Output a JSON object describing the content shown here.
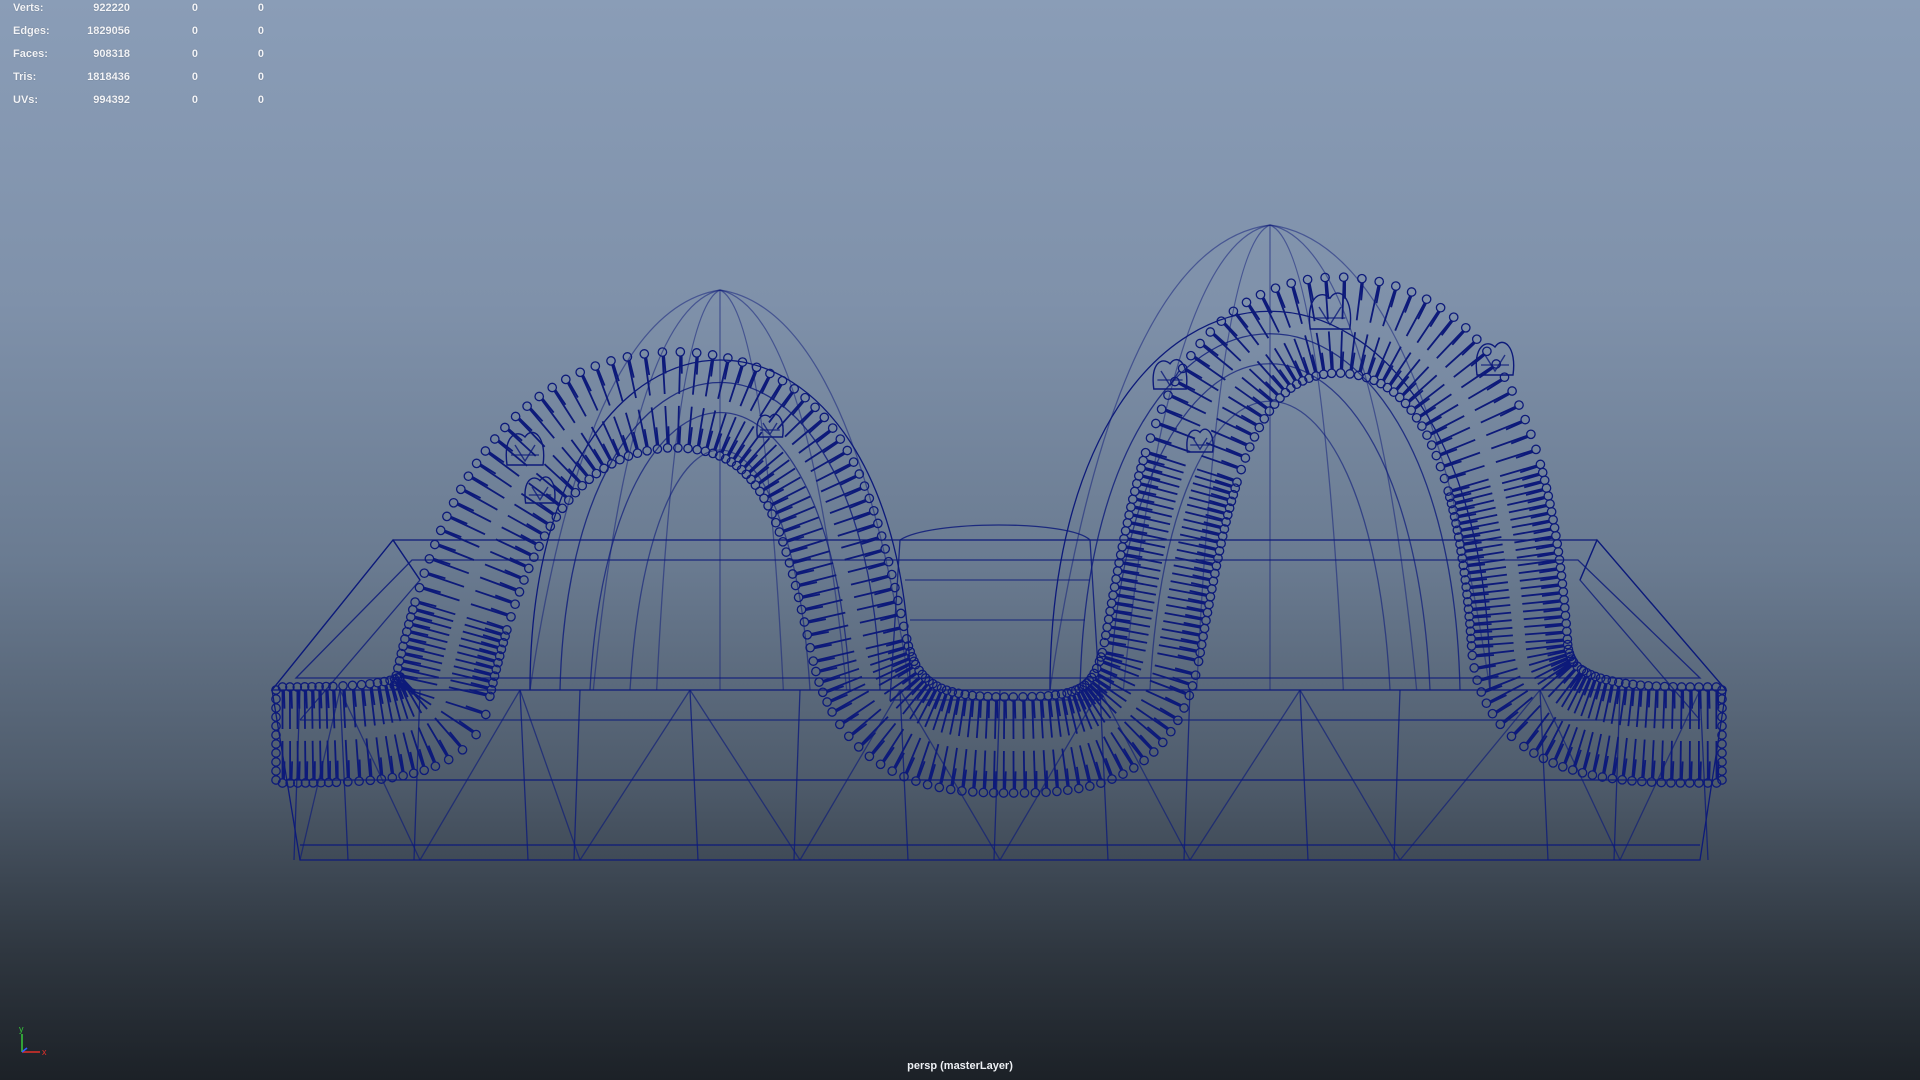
{
  "hud": {
    "rows": [
      {
        "label": "Verts:",
        "total": "922220",
        "selected": "0",
        "component": "0"
      },
      {
        "label": "Edges:",
        "total": "1829056",
        "selected": "0",
        "component": "0"
      },
      {
        "label": "Faces:",
        "total": "908318",
        "selected": "0",
        "component": "0"
      },
      {
        "label": "Tris:",
        "total": "1818436",
        "selected": "0",
        "component": "0"
      },
      {
        "label": "UVs:",
        "total": "994392",
        "selected": "0",
        "component": "0"
      }
    ]
  },
  "viewport": {
    "camera_label": "persp (masterLayer)",
    "wire_color": "#0d1a7a",
    "background_top": "#8a9db7",
    "background_bottom": "#1c2127"
  },
  "axis_gizmo": {
    "x_label": "x",
    "y_label": "y",
    "x_color": "#e0302a",
    "y_color": "#36c23a",
    "z_color": "#2f5fff"
  }
}
